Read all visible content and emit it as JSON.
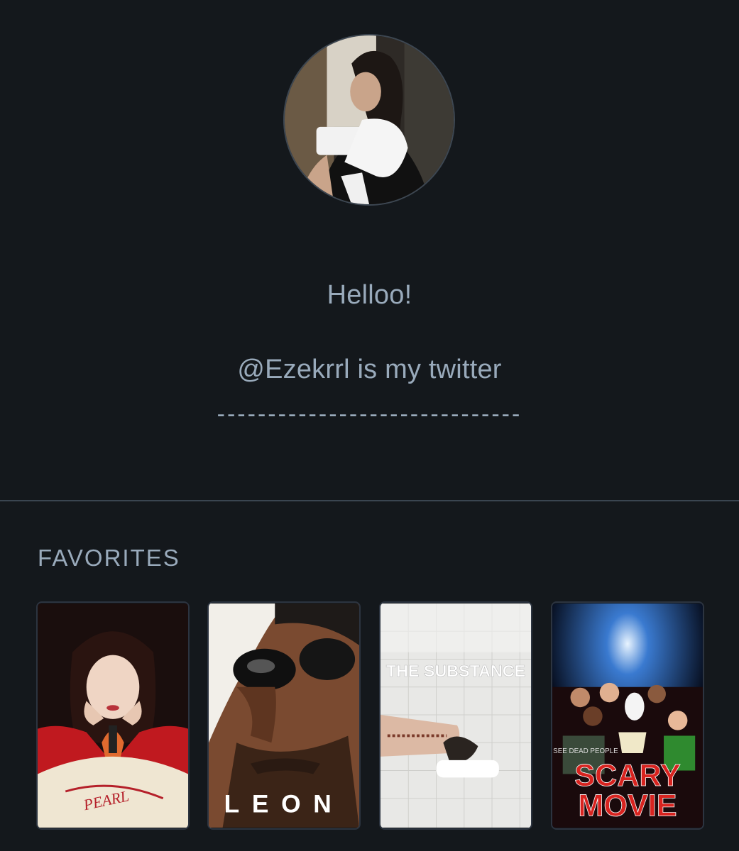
{
  "profile": {
    "avatar_alt": "profile-avatar"
  },
  "bio": {
    "line1": "Helloo!",
    "line2": "@Ezekrrl is my twitter",
    "line3": "------------------------------"
  },
  "favorites": {
    "heading": "FAVORITES",
    "films": [
      {
        "poster_text": "PEARL"
      },
      {
        "poster_text": "LEON"
      },
      {
        "poster_text": "THE SUBSTANCE"
      },
      {
        "poster_text_1": "SCARY",
        "poster_text_2": "MOVIE",
        "poster_small_text": "I SEE DEAD PEOPLE"
      }
    ]
  },
  "colors": {
    "background": "#14181c",
    "text": "#99aabb",
    "divider": "#3a4550"
  }
}
